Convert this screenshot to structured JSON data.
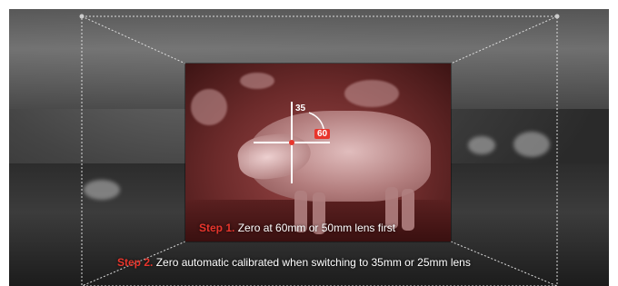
{
  "steps": [
    {
      "number": "Step 1.",
      "text": "Zero at 60mm or 50mm lens first"
    },
    {
      "number": "Step 2.",
      "text": "Zero automatic calibrated when switching to 35mm or 25mm lens"
    }
  ],
  "lens_labels": {
    "near": "35",
    "far": "60"
  },
  "colors": {
    "accent": "#e8352c",
    "zoom_tint": "#7a2e2e"
  },
  "icons": [
    "reticle-icon",
    "arrow-arc-icon"
  ]
}
